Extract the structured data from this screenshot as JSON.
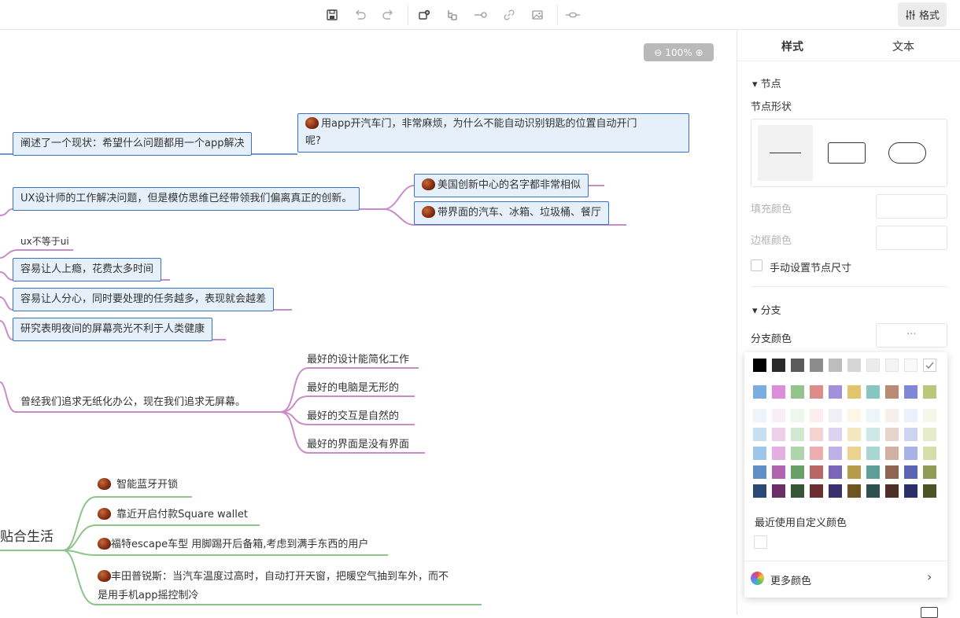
{
  "toolbar": {
    "icons": [
      "save-icon",
      "undo-icon",
      "redo-icon",
      "add-topic-icon",
      "add-subtopic-icon",
      "relation-icon",
      "link-icon",
      "image-icon",
      "summary-icon"
    ],
    "format_label": "格式"
  },
  "canvas": {
    "zoom": "100%",
    "nodes": {
      "n1": "阐述了一个现状：希望什么问题都用一个app解决",
      "n1a_l1": "用app开汽车门，非常麻烦，为什么不能自动识别钥匙的位置自动开门",
      "n1a_l2": "呢?",
      "n2": "UX设计师的工作解决问题，但是模仿思维已经带领我们偏离真正的创新。",
      "n2a": "美国创新中心的名字都非常相似",
      "n2b": "带界面的汽车、冰箱、垃圾桶、餐厅",
      "n3": "ux不等于ui",
      "n4": "容易让人上瘾，花费太多时间",
      "n5": "容易让人分心，同时要处理的任务越多，表现就会越差",
      "n6": "研究表明夜间的屏幕亮光不利于人类健康",
      "n7": "曾经我们追求无纸化办公，现在我们追求无屏幕。",
      "n7a": "最好的设计能简化工作",
      "n7b": "最好的电脑是无形的",
      "n7c": "最好的交互是自然的",
      "n7d": "最好的界面是没有界面",
      "n8": "贴合生活",
      "n8a": "智能蓝牙开锁",
      "n8b": "靠近开启付款Square wallet",
      "n8c": "福特escape车型 用脚踢开后备箱,考虑到满手东西的用户",
      "n8d_l1": "丰田普锐斯：当汽车温度过高时，自动打开天窗，把暖空气抽到车外，而不",
      "n8d_l2": "是用手机app摇控制冷"
    }
  },
  "panel": {
    "tab_style": "样式",
    "tab_text": "文本",
    "node_section": "节点",
    "node_shape": "节点形状",
    "fill_color": "填充颜色",
    "border_color": "边框颜色",
    "manual_size": "手动设置节点尺寸",
    "branch_section": "分支",
    "branch_color": "分支颜色",
    "branch_color_value": "···"
  },
  "palette": {
    "row1": [
      "#000000",
      "#2b2b2b",
      "#5a5a5a",
      "#8c8c8c",
      "#bdbdbd",
      "#d6d6d6",
      "#ebebeb",
      "#f4f4f4",
      "#f9f9f9",
      "#ffffff"
    ],
    "row2": [
      "#7aaee0",
      "#dc8fd6",
      "#93c38e",
      "#de8c8a",
      "#a290dc",
      "#e2c46c",
      "#85c6c0",
      "#b98b74",
      "#7f88d6",
      "#bcc77e"
    ],
    "row3": [
      "#eef4fb",
      "#f8eef8",
      "#eef6ee",
      "#fbeeee",
      "#f1eefa",
      "#fbf6e6",
      "#ecf6f6",
      "#f6efec",
      "#edf0fa",
      "#f5f7ea"
    ],
    "row4": [
      "#c8dff3",
      "#ecd0ea",
      "#d1e8d0",
      "#f4d3d2",
      "#dcd3f2",
      "#f4e6bf",
      "#cde8e5",
      "#e6d3c9",
      "#cdd3f1",
      "#e6ebcb"
    ],
    "row5": [
      "#9ec6ea",
      "#e3aee0",
      "#aed4aa",
      "#e9aead",
      "#bdb1e8",
      "#ebd28f",
      "#a9d6d2",
      "#d2b1a2",
      "#a9b2e6",
      "#d4dea6"
    ],
    "row6": [
      "#5f8fc5",
      "#b064b0",
      "#6a9f68",
      "#b86766",
      "#7a66b8",
      "#b89a4c",
      "#5f9e99",
      "#8f6453",
      "#5c65b4",
      "#8e9c58"
    ],
    "row7": [
      "#284a74",
      "#6a2f68",
      "#355535",
      "#6b2f30",
      "#3b2f6e",
      "#6e5524",
      "#2c524f",
      "#4f2f25",
      "#2a2f6a",
      "#4a5427"
    ],
    "recent_label": "最近使用自定义颜色",
    "more_label": "更多颜色",
    "selected": "#ffffff"
  }
}
